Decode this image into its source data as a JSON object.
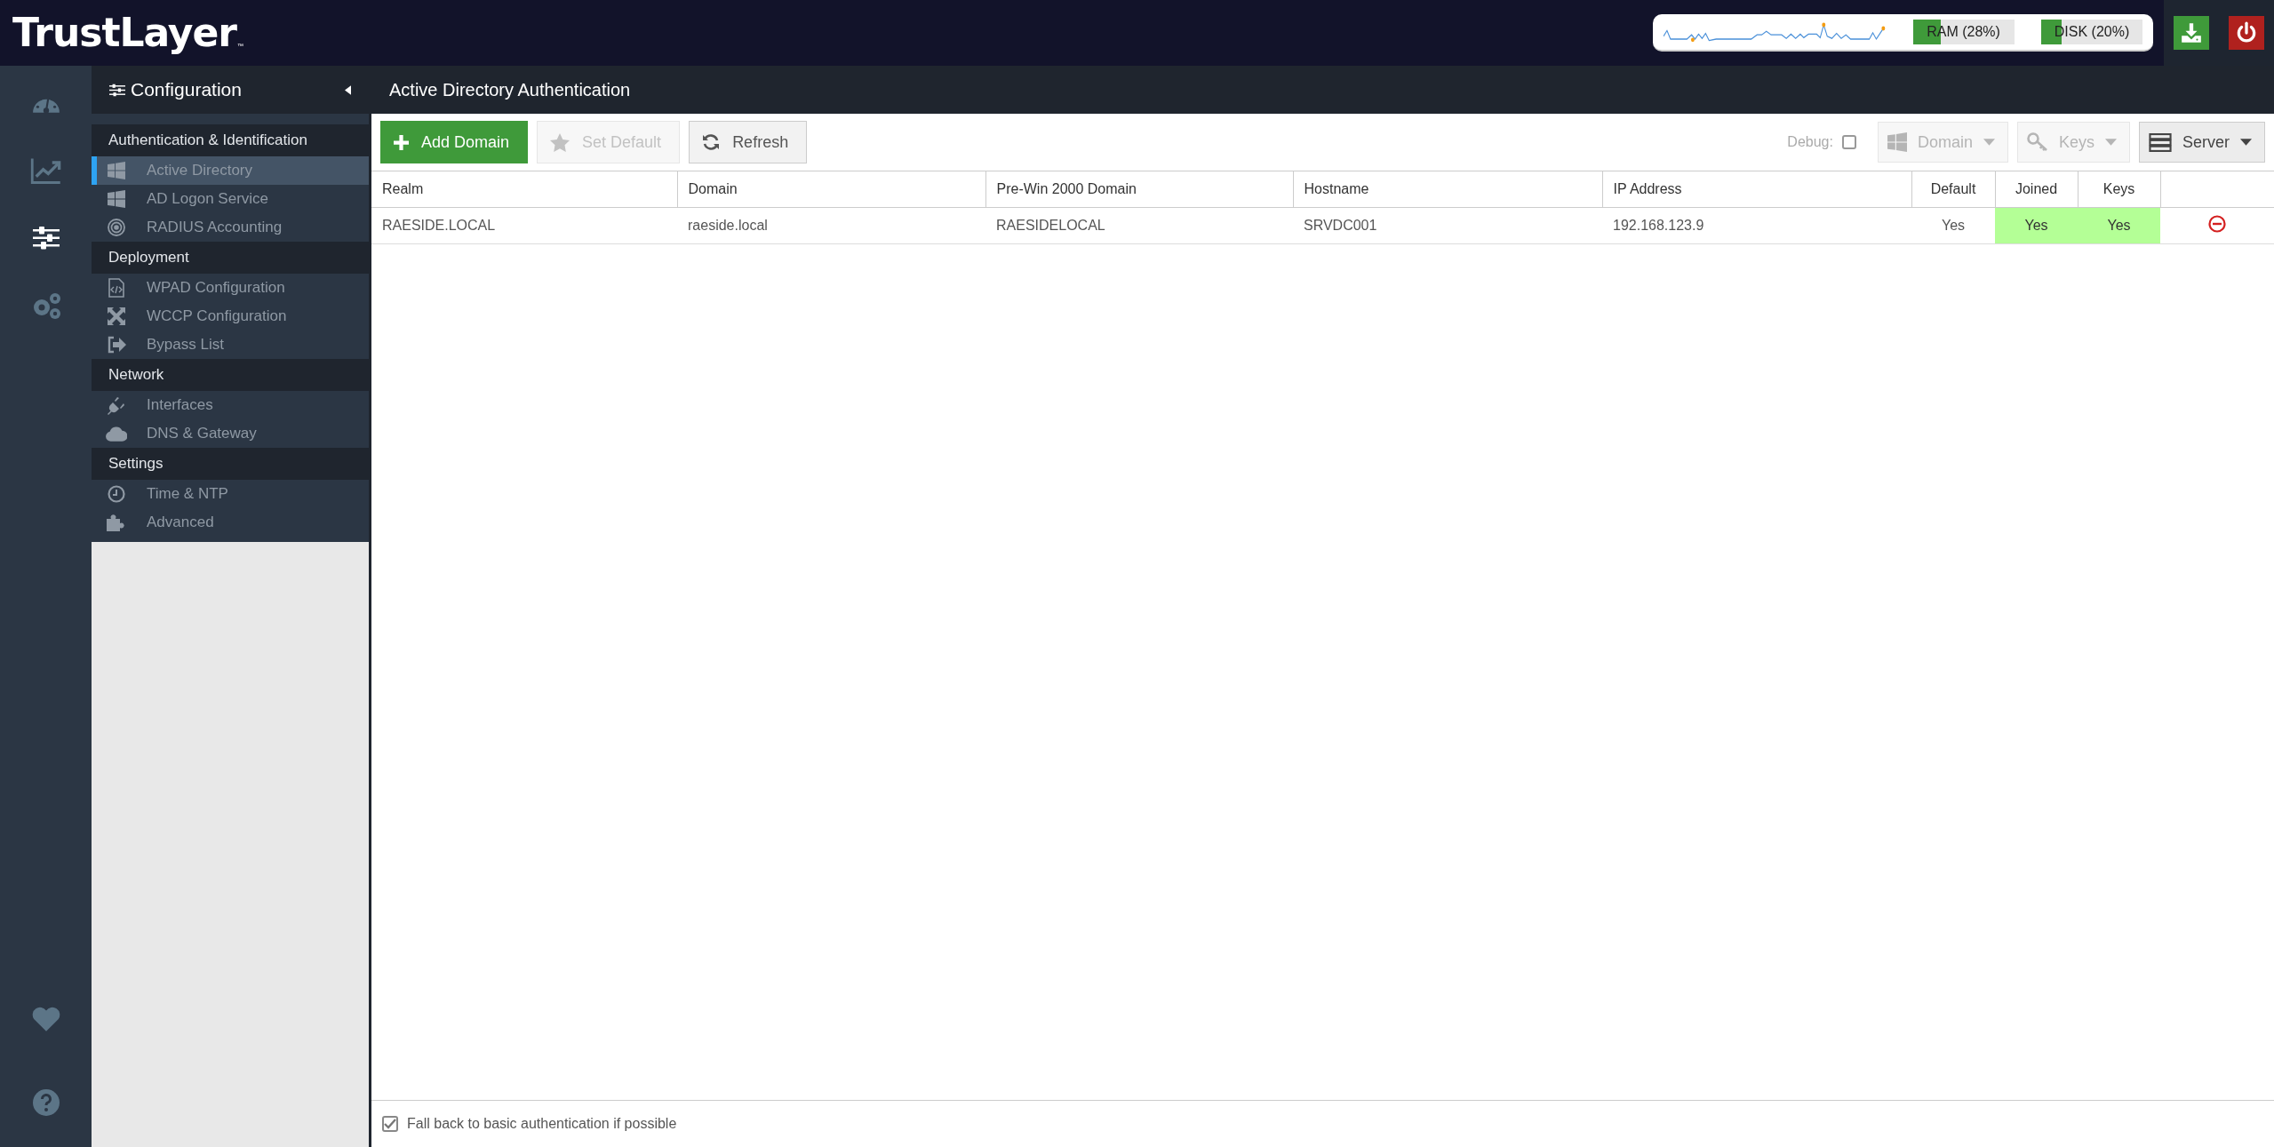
{
  "header": {
    "logo": "TrustLayer",
    "trademark": "™",
    "meters": [
      {
        "label": "RAM (28%)",
        "level": 0.28
      },
      {
        "label": "DISK (20%)",
        "level": 0.2
      }
    ]
  },
  "rail": {
    "items": [
      {
        "selected": false
      },
      {
        "selected": false
      },
      {
        "selected": true
      },
      {
        "selected": false
      }
    ],
    "bottom_items": [
      {
        "selected": false
      },
      {
        "selected": false
      }
    ]
  },
  "panel": {
    "title": "Configuration",
    "sections": [
      {
        "title": "Authentication & Identification",
        "items": [
          {
            "label": "Active Directory",
            "selected": true
          },
          {
            "label": "AD Logon Service",
            "selected": false
          },
          {
            "label": "RADIUS Accounting",
            "selected": false
          }
        ]
      },
      {
        "title": "Deployment",
        "items": [
          {
            "label": "WPAD Configuration",
            "selected": false
          },
          {
            "label": "WCCP Configuration",
            "selected": false
          },
          {
            "label": "Bypass List",
            "selected": false
          }
        ]
      },
      {
        "title": "Network",
        "items": [
          {
            "label": "Interfaces",
            "selected": false
          },
          {
            "label": "DNS & Gateway",
            "selected": false
          }
        ]
      },
      {
        "title": "Settings",
        "items": [
          {
            "label": "Time & NTP",
            "selected": false
          },
          {
            "label": "Advanced",
            "selected": false
          }
        ]
      }
    ]
  },
  "main": {
    "title": "Active Directory Authentication",
    "toolbar": {
      "buttons": [
        {
          "label": "Add Domain",
          "kind": "primary",
          "disabled": false
        },
        {
          "label": "Set Default",
          "kind": "plain",
          "disabled": true
        },
        {
          "label": "Refresh",
          "kind": "plain",
          "disabled": false
        }
      ],
      "debug": {
        "label": "Debug:",
        "checked": false
      },
      "dropdowns": [
        {
          "label": "Domain",
          "disabled": true
        },
        {
          "label": "Keys",
          "disabled": true
        },
        {
          "label": "Server",
          "disabled": false
        }
      ]
    },
    "table": {
      "columns": [
        {
          "label": "Realm"
        },
        {
          "label": "Domain"
        },
        {
          "label": "Pre-Win 2000 Domain"
        },
        {
          "label": "Hostname"
        },
        {
          "label": "IP Address"
        },
        {
          "label": "Default"
        },
        {
          "label": "Joined"
        },
        {
          "label": "Keys"
        }
      ],
      "rows": [
        {
          "cells": [
            {
              "text": "RAESIDE.LOCAL",
              "highlighted": false
            },
            {
              "text": "raeside.local",
              "highlighted": false
            },
            {
              "text": "RAESIDELOCAL",
              "highlighted": false
            },
            {
              "text": "SRVDC001",
              "highlighted": false
            },
            {
              "text": "192.168.123.9",
              "highlighted": false
            },
            {
              "text": "Yes",
              "highlighted": false
            },
            {
              "text": "Yes",
              "highlighted": true
            },
            {
              "text": "Yes",
              "highlighted": true
            }
          ]
        }
      ]
    },
    "footer": {
      "label": "Fall back to basic authentication if possible",
      "checked": true
    }
  }
}
